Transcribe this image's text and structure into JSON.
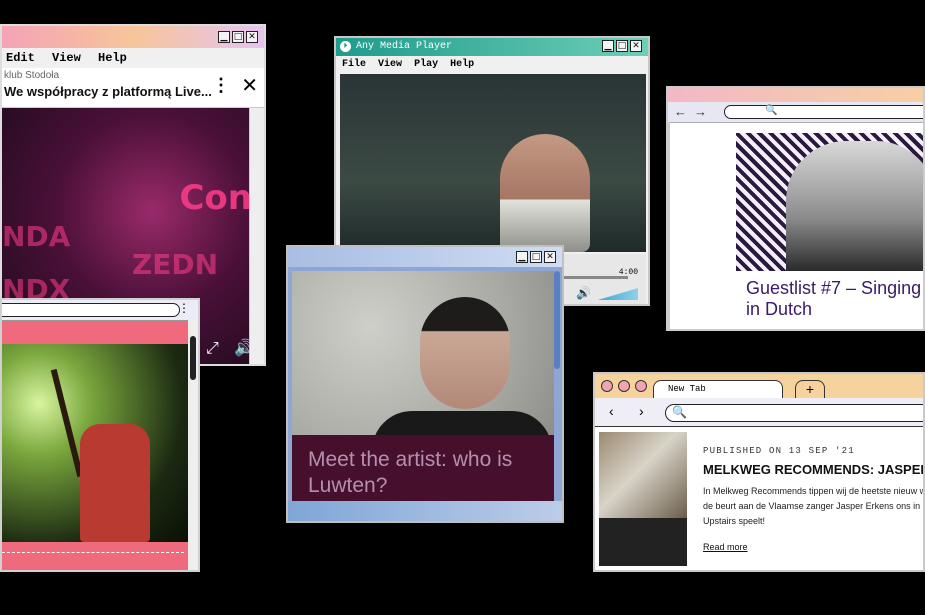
{
  "window_social": {
    "menu": [
      "Edit",
      "View",
      "Help"
    ],
    "source": "klub Stodoła",
    "title": "We współpracy z platformą Live...",
    "video_text": [
      "Con",
      "NDA",
      "ZEDN",
      "NDX"
    ],
    "controls": {
      "more": "⋮",
      "close": "✕",
      "expand": "⤢",
      "volume": "🔊"
    }
  },
  "window_player": {
    "title": "Any Media Player",
    "menu": [
      "File",
      "View",
      "Play",
      "Help"
    ],
    "time": "4:00",
    "progress_fraction": 0.0
  },
  "window_guestlist": {
    "headline": "Guestlist #7 – Singing in Dutch"
  },
  "window_artist": {
    "caption": "Meet the artist: who is Luwten?"
  },
  "window_melkweg": {
    "tab_label": "New Tab",
    "published": "PUBLISHED ON 13 SEP '21",
    "title": "MELKWEG RECOMMENDS: JASPER",
    "body": "In Melkweg Recommends tippen wij de heetste nieuw week de beurt aan de Vlaamse zanger Jasper Erkens ons in de Upstairs speelt!",
    "read_more": "Read more"
  },
  "colors": {
    "accent_pink": "#f06a7e",
    "accent_teal": "#1f9b8c",
    "caption_bg": "#46102c",
    "guestlist_text": "#3a1a6a"
  }
}
